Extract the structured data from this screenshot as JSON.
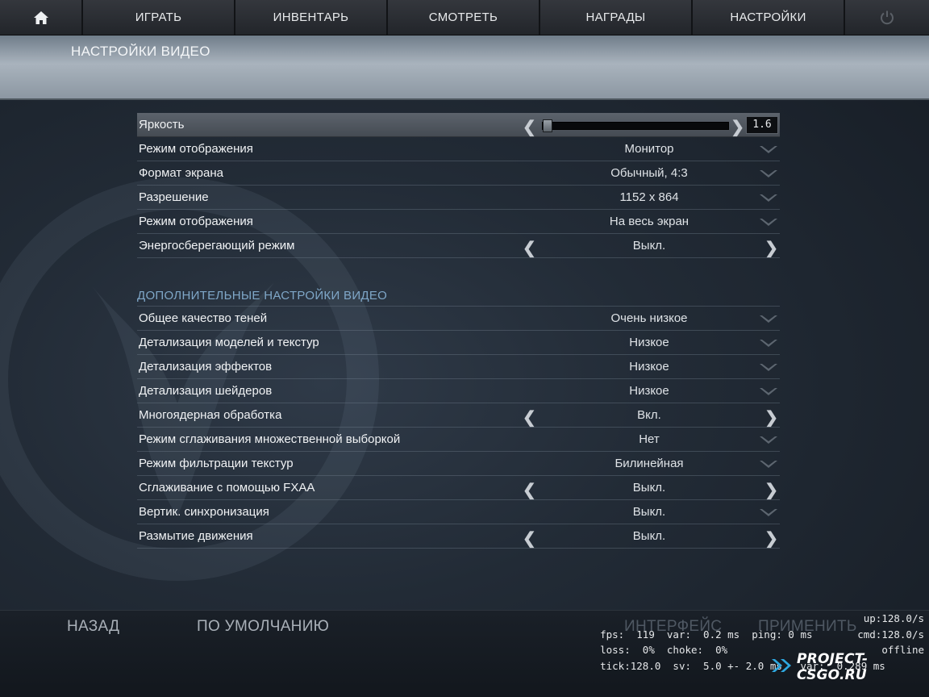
{
  "topnav": {
    "home_icon": "home-icon",
    "items": [
      "ИГРАТЬ",
      "ИНВЕНТАРЬ",
      "СМОТРЕТЬ",
      "НАГРАДЫ",
      "НАСТРОЙКИ"
    ],
    "power_icon": "power-icon"
  },
  "page_title": "НАСТРОЙКИ ВИДЕО",
  "video": {
    "brightness": {
      "label": "Яркость",
      "value": "1.6",
      "fraction": 0.0
    },
    "rows": [
      {
        "label": "Режим отображения",
        "value": "Монитор",
        "control": "dropdown"
      },
      {
        "label": "Формат экрана",
        "value": "Обычный, 4:3",
        "control": "dropdown"
      },
      {
        "label": "Разрешение",
        "value": "1152 x 864",
        "control": "dropdown"
      },
      {
        "label": "Режим отображения",
        "value": "На весь экран",
        "control": "dropdown"
      },
      {
        "label": "Энергосберегающий режим",
        "value": "Выкл.",
        "control": "arrows"
      }
    ]
  },
  "advanced": {
    "title": "ДОПОЛНИТЕЛЬНЫЕ НАСТРОЙКИ ВИДЕО",
    "rows": [
      {
        "label": "Общее качество теней",
        "value": "Очень низкое",
        "control": "dropdown"
      },
      {
        "label": "Детализация моделей и текстур",
        "value": "Низкое",
        "control": "dropdown"
      },
      {
        "label": "Детализация эффектов",
        "value": "Низкое",
        "control": "dropdown"
      },
      {
        "label": "Детализация шейдеров",
        "value": "Низкое",
        "control": "dropdown"
      },
      {
        "label": "Многоядерная обработка",
        "value": "Вкл.",
        "control": "arrows"
      },
      {
        "label": "Режим сглаживания множественной выборкой",
        "value": "Нет",
        "control": "dropdown"
      },
      {
        "label": "Режим фильтрации текстур",
        "value": "Билинейная",
        "control": "dropdown"
      },
      {
        "label": "Сглаживание с помощью FXAA",
        "value": "Выкл.",
        "control": "arrows"
      },
      {
        "label": "Вертик. синхронизация",
        "value": "Выкл.",
        "control": "dropdown"
      },
      {
        "label": "Размытие движения",
        "value": "Выкл.",
        "control": "arrows"
      }
    ]
  },
  "bottom": {
    "back": "НАЗАД",
    "default": "ПО УМОЛЧАНИЮ",
    "interface": "ИНТЕРФЕЙС",
    "apply": "ПРИМЕНИТЬ"
  },
  "netgraph": {
    "line1": "fps:  119  var:  0.2 ms  ping: 0 ms",
    "line1_right": "up:128.0/s",
    "line2": "loss:  0%  choke:  0%",
    "line2_right": "cmd:128.0/s",
    "line3": "tick:128.0  sv:  5.0 +- 2.0 ms   var:  0.289 ms",
    "line3_right": "offline"
  },
  "brand": {
    "text": "PROJECT-CSGO.RU",
    "icon": "double-chevron-icon"
  },
  "colors": {
    "section_title": "#7fa7c8",
    "row_active": "#5c636c",
    "background": "#222b36"
  }
}
